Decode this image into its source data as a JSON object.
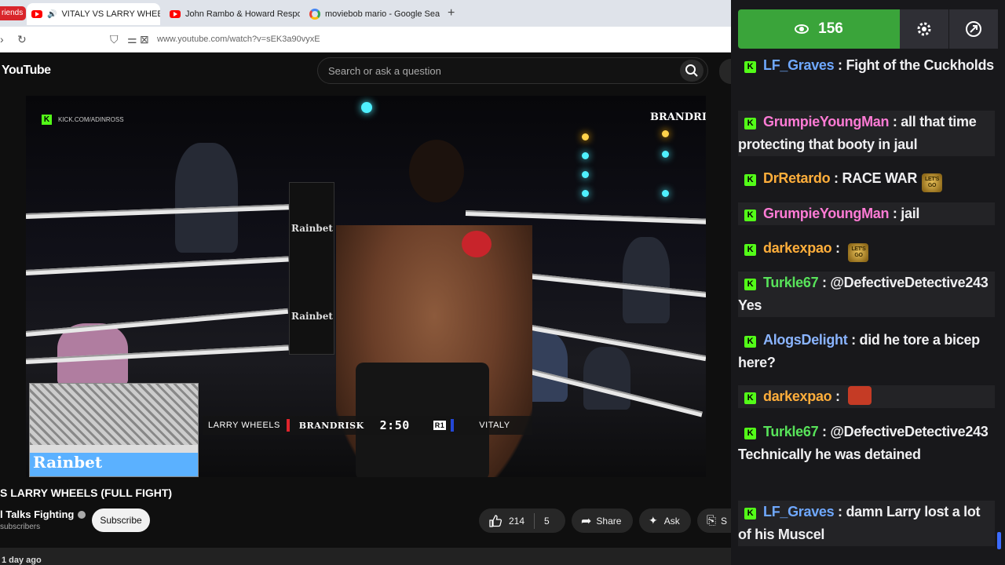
{
  "browser": {
    "tabs": [
      {
        "label": "riends",
        "kind": "pill"
      },
      {
        "label": "VITALY VS LARRY WHEELS (",
        "active": true,
        "audio": true
      },
      {
        "label": "John Rambo & Howard Respon"
      },
      {
        "label": "moviebob mario - Google Searc"
      }
    ],
    "url": "www.youtube.com/watch?v=sEK3a90vyxE"
  },
  "youtube": {
    "logo": "YouTube",
    "search_placeholder": "Search or ask a question",
    "video": {
      "watermark_kick": "KICK.COM/ADINROSS",
      "watermark_brand": "BRANDRISK",
      "ring_sponsor": "Rainbet",
      "pip_sponsor": "Rainbet",
      "scoreboard": {
        "fighter_left": "LARRY WHEELS",
        "logo": "BRANDRISK",
        "clock": "2:50",
        "round": "R1",
        "fighter_right": "VITALY"
      }
    },
    "title": "S LARRY WHEELS (FULL FIGHT)",
    "channel": "l Talks Fighting",
    "subscribers": "subscribers",
    "subscribe_label": "Subscribe",
    "likes": "214",
    "dislikes": "5",
    "share_label": "Share",
    "ask_label": "Ask",
    "save_label": "S",
    "age": "1 day ago"
  },
  "chat": {
    "viewers": "156",
    "colors": {
      "viewer_box": "#3aa43a",
      "kick": "#53fc18"
    },
    "messages": [
      {
        "user": "LF_Graves",
        "color": "#6fa8ff",
        "text": "Fight of the Cuckholds"
      },
      {
        "user": "GrumpieYoungMan",
        "color": "#ff7bd5",
        "text": "all that time protecting that booty in jaul"
      },
      {
        "user": "DrRetardo",
        "color": "#ffae3b",
        "text": "RACE WAR",
        "emote": "lets-go"
      },
      {
        "user": "GrumpieYoungMan",
        "color": "#ff7bd5",
        "text": "jail"
      },
      {
        "user": "darkexpao",
        "color": "#ffae3b",
        "text": "",
        "emote": "lets-go"
      },
      {
        "user": "Turkle67",
        "color": "#58e35a",
        "text": "@DefectiveDetective243 Yes"
      },
      {
        "user": "AlogsDelight",
        "color": "#8ab4ff",
        "text": "did he tore a bicep here?"
      },
      {
        "user": "darkexpao",
        "color": "#ffae3b",
        "text": "",
        "emote": "face"
      },
      {
        "user": "Turkle67",
        "color": "#58e35a",
        "text": "@DefectiveDetective243 Technically he was detained"
      },
      {
        "user": "LF_Graves",
        "color": "#6fa8ff",
        "text": "damn Larry lost a lot of his Muscel"
      }
    ]
  }
}
